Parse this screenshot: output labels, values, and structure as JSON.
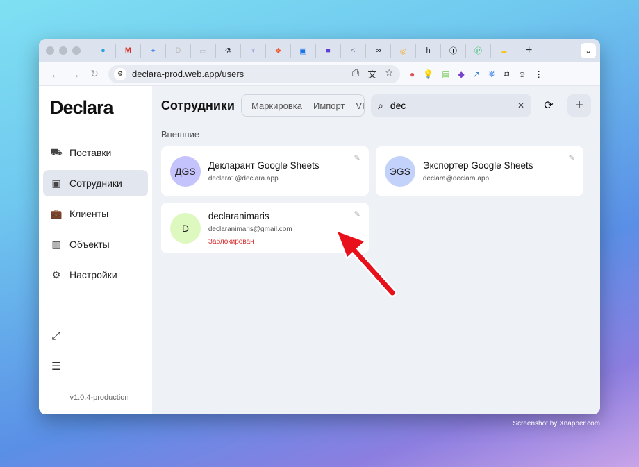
{
  "browser": {
    "tabs": [
      "telegram",
      "gmail",
      "gemini",
      "declara",
      "doc",
      "flask",
      "octopus",
      "figma",
      "calendar",
      "vpn",
      "code",
      "infinity",
      "circle",
      "h",
      "T",
      "P",
      "cloud"
    ],
    "url": "declara-prod.web.app/users"
  },
  "sidebar": {
    "logo": "Declara",
    "items": [
      {
        "label": "Поставки",
        "icon": "truck-icon"
      },
      {
        "label": "Сотрудники",
        "icon": "badge-icon",
        "active": true
      },
      {
        "label": "Клиенты",
        "icon": "briefcase-icon"
      },
      {
        "label": "Объекты",
        "icon": "building-icon"
      },
      {
        "label": "Настройки",
        "icon": "gear-icon"
      }
    ],
    "version": "v1.0.4-production"
  },
  "main": {
    "title": "Сотрудники",
    "tabs": [
      "Маркировка",
      "Импорт",
      "VIP"
    ],
    "search_value": "dec",
    "section": "Внешние",
    "users": [
      {
        "initials": "ДGS",
        "name": "Декларант Google Sheets",
        "email": "declara1@declara.app",
        "color": "#c5c3fb"
      },
      {
        "initials": "ЭGS",
        "name": "Экспортер Google Sheets",
        "email": "declara@declara.app",
        "color": "#c3d2fb"
      },
      {
        "initials": "D",
        "name": "declaranimaris",
        "email": "declaranimaris@gmail.com",
        "status": "Заблокирован",
        "color": "#def9bf"
      }
    ]
  },
  "watermark": "Screenshot by Xnapper.com"
}
